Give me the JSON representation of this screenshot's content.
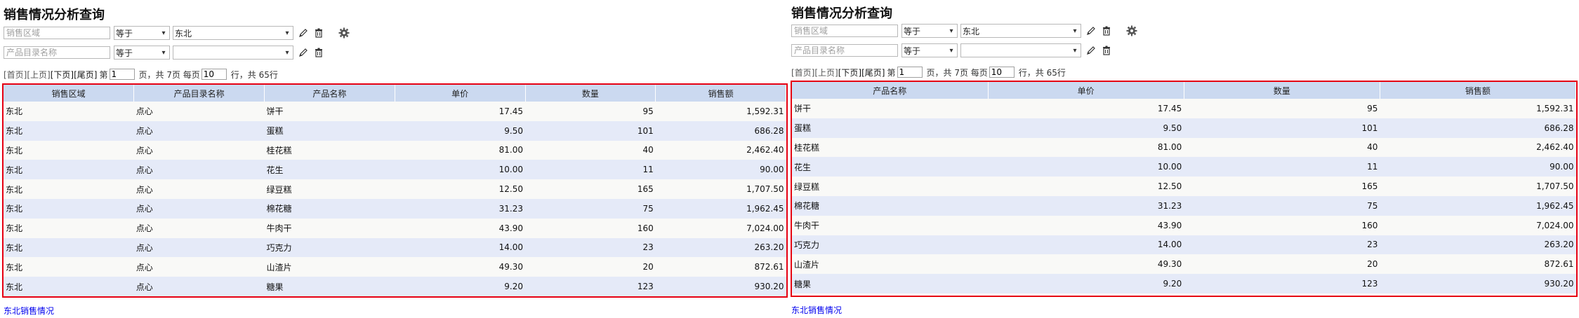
{
  "title": "销售情况分析查询",
  "filters": [
    {
      "placeholder": "销售区域",
      "operator": "等于",
      "value": "东北"
    },
    {
      "placeholder": "产品目录名称",
      "operator": "等于",
      "value": ""
    }
  ],
  "pager": {
    "first": "[首页]",
    "prev": "[上页]",
    "next": "[下页]",
    "last": "[尾页]",
    "page_prefix": "第",
    "page_value": "1",
    "total_pages_text": "页，共 7页 每页",
    "page_size": "10",
    "total_rows_text": "行，共 65行"
  },
  "footer_link": "东北销售情况",
  "icons": {
    "edit": "pencil-icon",
    "delete": "trash-icon",
    "settings": "gear-icon"
  },
  "colors": {
    "highlight_border": "#e60012",
    "header_bg": "#cbd9f0",
    "row_alt": "#e5eaf8",
    "link": "#0000ee"
  },
  "left_table": {
    "columns": [
      "销售区域",
      "产品目录名称",
      "产品名称",
      "单价",
      "数量",
      "销售额"
    ],
    "rows": [
      [
        "东北",
        "点心",
        "饼干",
        "17.45",
        "95",
        "1,592.31"
      ],
      [
        "东北",
        "点心",
        "蛋糕",
        "9.50",
        "101",
        "686.28"
      ],
      [
        "东北",
        "点心",
        "桂花糕",
        "81.00",
        "40",
        "2,462.40"
      ],
      [
        "东北",
        "点心",
        "花生",
        "10.00",
        "11",
        "90.00"
      ],
      [
        "东北",
        "点心",
        "绿豆糕",
        "12.50",
        "165",
        "1,707.50"
      ],
      [
        "东北",
        "点心",
        "棉花糖",
        "31.23",
        "75",
        "1,962.45"
      ],
      [
        "东北",
        "点心",
        "牛肉干",
        "43.90",
        "160",
        "7,024.00"
      ],
      [
        "东北",
        "点心",
        "巧克力",
        "14.00",
        "23",
        "263.20"
      ],
      [
        "东北",
        "点心",
        "山渣片",
        "49.30",
        "20",
        "872.61"
      ],
      [
        "东北",
        "点心",
        "糖果",
        "9.20",
        "123",
        "930.20"
      ]
    ]
  },
  "right_table": {
    "columns": [
      "产品名称",
      "单价",
      "数量",
      "销售额"
    ],
    "rows": [
      [
        "饼干",
        "17.45",
        "95",
        "1,592.31"
      ],
      [
        "蛋糕",
        "9.50",
        "101",
        "686.28"
      ],
      [
        "桂花糕",
        "81.00",
        "40",
        "2,462.40"
      ],
      [
        "花生",
        "10.00",
        "11",
        "90.00"
      ],
      [
        "绿豆糕",
        "12.50",
        "165",
        "1,707.50"
      ],
      [
        "棉花糖",
        "31.23",
        "75",
        "1,962.45"
      ],
      [
        "牛肉干",
        "43.90",
        "160",
        "7,024.00"
      ],
      [
        "巧克力",
        "14.00",
        "23",
        "263.20"
      ],
      [
        "山渣片",
        "49.30",
        "20",
        "872.61"
      ],
      [
        "糖果",
        "9.20",
        "123",
        "930.20"
      ]
    ]
  }
}
